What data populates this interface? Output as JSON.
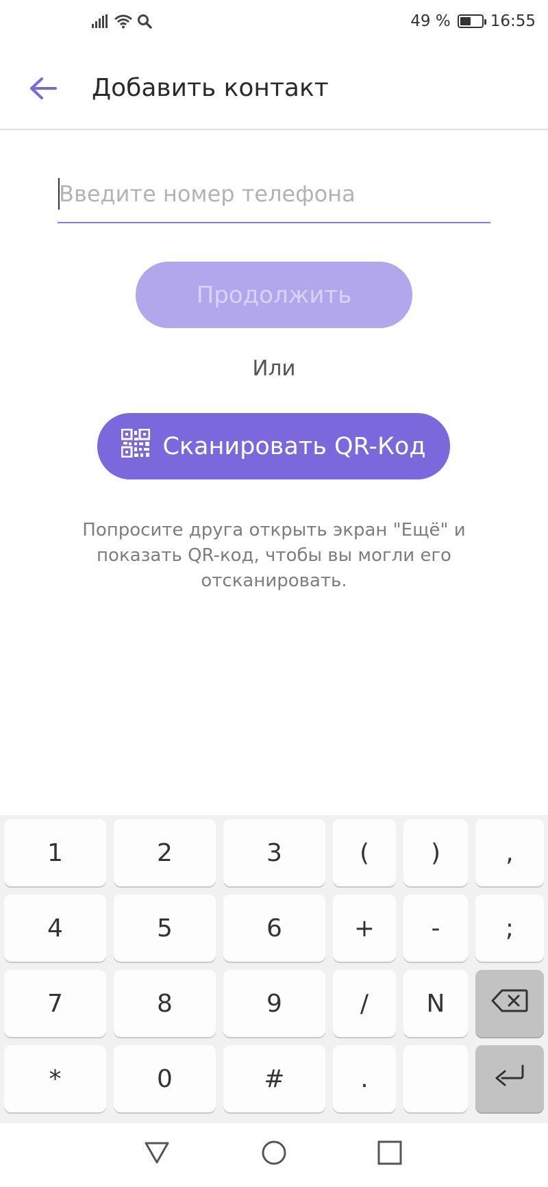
{
  "status_bar": {
    "battery_percent": "49 %",
    "battery_level": 0.49,
    "time": "16:55",
    "icons": [
      "signal-icon",
      "wifi-icon",
      "search-icon"
    ]
  },
  "app_bar": {
    "back_icon": "arrow-left-icon",
    "title": "Добавить контакт"
  },
  "phone_input": {
    "value": "",
    "placeholder": "Введите номер телефона"
  },
  "continue_button": {
    "label": "Продолжить"
  },
  "or_text": "Или",
  "qr_button": {
    "label": "Сканировать QR-Код",
    "icon": "qr-code-icon"
  },
  "hint": "Попросите друга открыть экран \"Ещё\" и показать QR-код, чтобы вы могли его отсканировать.",
  "keyboard": {
    "rows": [
      [
        "1",
        "2",
        "3",
        "(",
        ")",
        ","
      ],
      [
        "4",
        "5",
        "6",
        "+",
        "-",
        ";"
      ],
      [
        "7",
        "8",
        "9",
        "/",
        "N",
        ""
      ],
      [
        "*",
        "0",
        "#",
        ".",
        "",
        ""
      ]
    ],
    "special_keys": {
      "backspace_icon": "backspace-icon",
      "enter_icon": "enter-icon"
    }
  },
  "nav_bar": {
    "icons": [
      "back-triangle-icon",
      "home-circle-icon",
      "recents-square-icon"
    ]
  },
  "colors": {
    "accent": "#7a68dc",
    "accent_disabled": "#b2a7ec",
    "input_underline": "#8a79d6"
  }
}
